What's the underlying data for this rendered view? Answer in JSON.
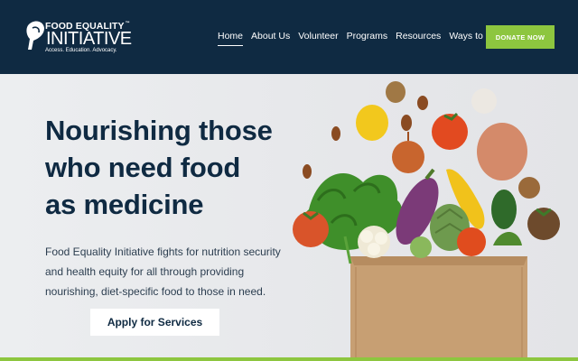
{
  "brand": {
    "line1": "FOOD EQUALITY",
    "trademark": "™",
    "line2": "INITIATIVE",
    "tagline": "Access. Education. Advocacy."
  },
  "nav": {
    "items": [
      "Home",
      "About Us",
      "Volunteer",
      "Programs",
      "Resources",
      "Ways to Give"
    ],
    "active": "Home"
  },
  "donate_label": "DONATE NOW",
  "hero": {
    "title_lines": [
      "Nourishing those",
      "who need food",
      "as medicine"
    ],
    "body_lines": [
      "Food Equality Initiative fights for nutrition security",
      "and health equity for all through providing",
      "nourishing, diet-specific food to those in need."
    ],
    "cta_label": "Apply for Services"
  },
  "colors": {
    "header_bg": "#0f2a42",
    "accent_green": "#8dc63f",
    "title_navy": "#0f2a42"
  }
}
